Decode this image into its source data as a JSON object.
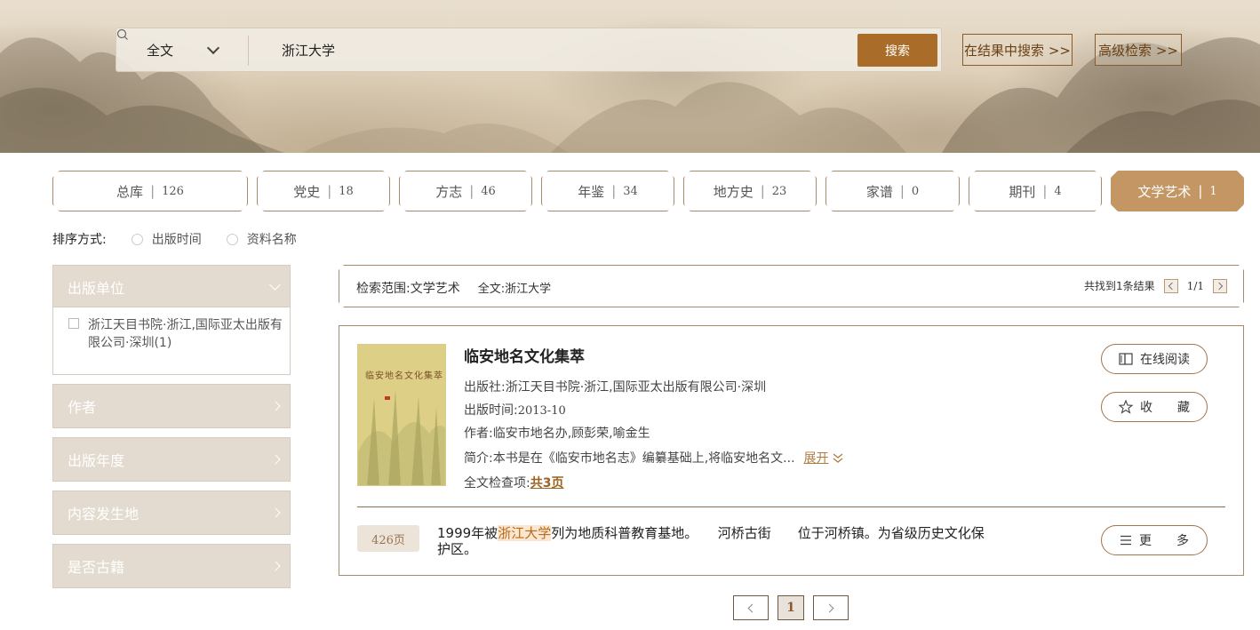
{
  "search": {
    "scope": "全文",
    "query": "浙江大学",
    "button": "搜索",
    "in_results": "在结果中搜索 >>",
    "advanced": "高级检索 >>"
  },
  "tabs": [
    {
      "label": "总库",
      "count": "126",
      "active": false
    },
    {
      "label": "党史",
      "count": "18",
      "active": false
    },
    {
      "label": "方志",
      "count": "46",
      "active": false
    },
    {
      "label": "年鉴",
      "count": "34",
      "active": false
    },
    {
      "label": "地方史",
      "count": "23",
      "active": false
    },
    {
      "label": "家谱",
      "count": "0",
      "active": false
    },
    {
      "label": "期刊",
      "count": "4",
      "active": false
    },
    {
      "label": "文学艺术",
      "count": "1",
      "active": true
    }
  ],
  "sort": {
    "label": "排序方式:",
    "options": [
      "出版时间",
      "资料名称"
    ]
  },
  "facets": {
    "publisher": {
      "title": "出版单位",
      "option": "浙江天目书院·浙江,国际亚太出版有限公司·深圳(1)"
    },
    "author": "作者",
    "year": "出版年度",
    "place": "内容发生地",
    "ancient": "是否古籍"
  },
  "result_header": {
    "scope": "检索范围:文学艺术",
    "query": "全文:浙江大学",
    "found": "共找到1条结果",
    "page": "1/1"
  },
  "result": {
    "title": "临安地名文化集萃",
    "cover_title": "临安地名文化集萃",
    "publisher": "出版社:浙江天目书院·浙江,国际亚太出版有限公司·深圳",
    "date_label": "出版时间:",
    "date": "2013-10",
    "authors": "作者:临安市地名办,顾彭荣,喻金生",
    "summary": "简介:本书是在《临安市地名志》编纂基础上,将临安地名文...",
    "expand": "展开",
    "fulltext_label": "全文检查项:",
    "fulltext_pages": "共3页",
    "read_online": "在线阅读",
    "favorite": "收　　藏",
    "more": "更　　多",
    "hit_page": "426页",
    "snippet_before": "1999年被",
    "snippet_hl": "浙江大学",
    "snippet_after": "列为地质科普教育基地。　　河桥古街　　位于河桥镇。为省级历史文化保护区。"
  },
  "pager": {
    "current": "1"
  },
  "colors": {
    "accent": "#a96d29",
    "tab_active": "#c39664",
    "facet_bg": "#e3dbd0",
    "border": "#a78b6c"
  }
}
